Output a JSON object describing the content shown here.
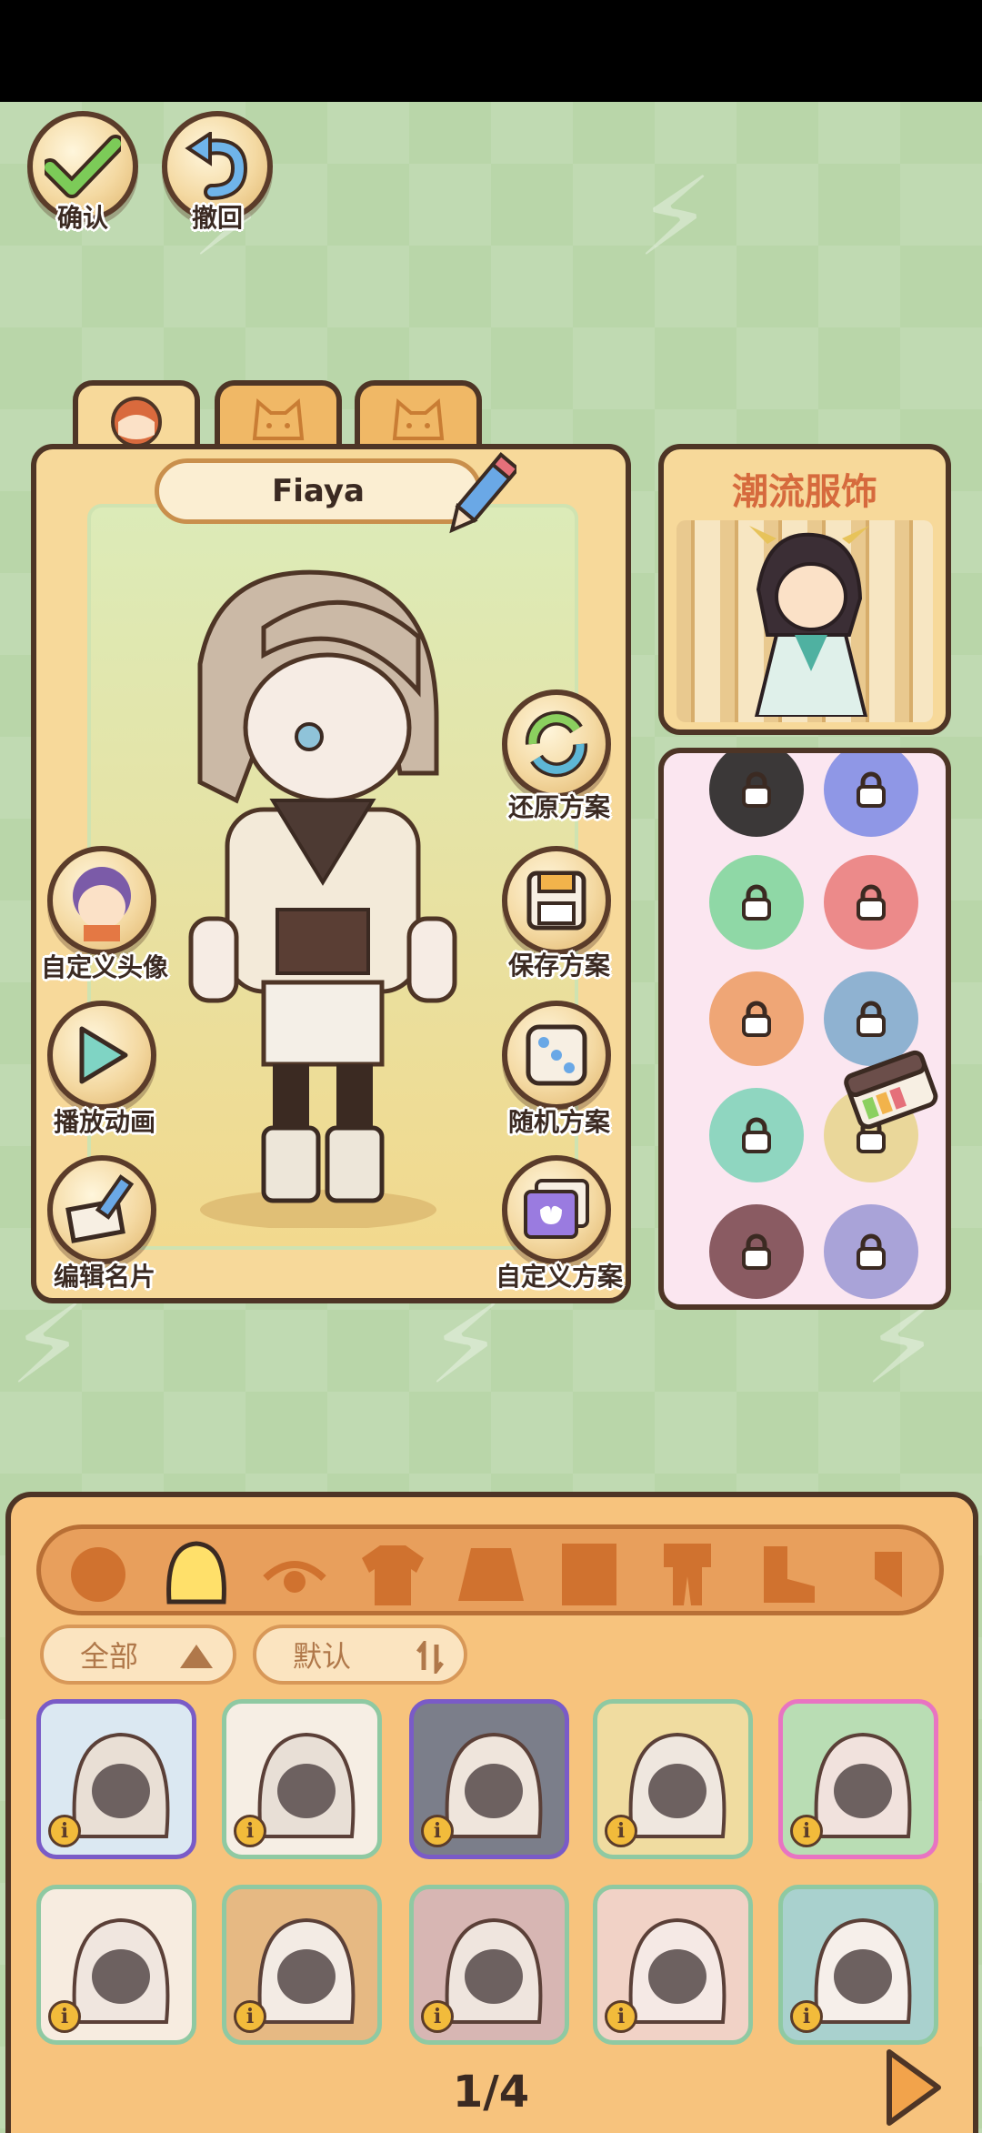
{
  "toolbar": {
    "confirm_label": "确认",
    "undo_label": "撤回"
  },
  "character": {
    "name": "Fiaya"
  },
  "side_actions": {
    "left": [
      {
        "label": "自定义头像",
        "icon": "avatar-icon"
      },
      {
        "label": "播放动画",
        "icon": "play-icon"
      },
      {
        "label": "编辑名片",
        "icon": "edit-card-icon"
      }
    ],
    "right": [
      {
        "label": "还原方案",
        "icon": "restore-icon"
      },
      {
        "label": "保存方案",
        "icon": "save-icon"
      },
      {
        "label": "随机方案",
        "icon": "dice-icon"
      },
      {
        "label": "自定义方案",
        "icon": "custom-plan-icon"
      }
    ]
  },
  "fashion_card": {
    "title": "潮流服饰"
  },
  "colors": {
    "swatches": [
      "#3b3838",
      "#8f97e6",
      "#8fd8a6",
      "#ec8a8a",
      "#efa676",
      "#8fb2d1",
      "#8fd6c0",
      "#ead79a",
      "#8a5b62",
      "#a9a3d8"
    ]
  },
  "filters": {
    "category_label": "全部",
    "sort_label": "默认"
  },
  "categories": [
    "face-icon",
    "hair-icon",
    "eye-icon",
    "top-icon",
    "skirt-icon",
    "dress-icon",
    "outfit-icon",
    "shoe-icon",
    "accessory-icon"
  ],
  "items": [
    {
      "bg": "#dbe8f2",
      "border": "#7a5bc7",
      "hair": "#e9dfd5"
    },
    {
      "bg": "#f6eee4",
      "border": "#8fc9a2",
      "hair": "#e8dfd6"
    },
    {
      "bg": "#7b7e8a",
      "border": "#7a5bc7",
      "hair": "#efe5dc"
    },
    {
      "bg": "#f0dca0",
      "border": "#8fc9a2",
      "hair": "#efe7df"
    },
    {
      "bg": "#b9ddb4",
      "border": "#e874c2",
      "hair": "#f1e2dd"
    },
    {
      "bg": "#f7ece0",
      "border": "#8fc9a2",
      "hair": "#f0e6df"
    },
    {
      "bg": "#e6b983",
      "border": "#8fc9a2",
      "hair": "#f3ebe4"
    },
    {
      "bg": "#d7b6b3",
      "border": "#8fc9a2",
      "hair": "#efe5de"
    },
    {
      "bg": "#f1d2c6",
      "border": "#8fc9a2",
      "hair": "#f5e9e5"
    },
    {
      "bg": "#a9d1ce",
      "border": "#8fc9a2",
      "hair": "#f6efea"
    }
  ],
  "pagination": {
    "label": "1/4"
  }
}
